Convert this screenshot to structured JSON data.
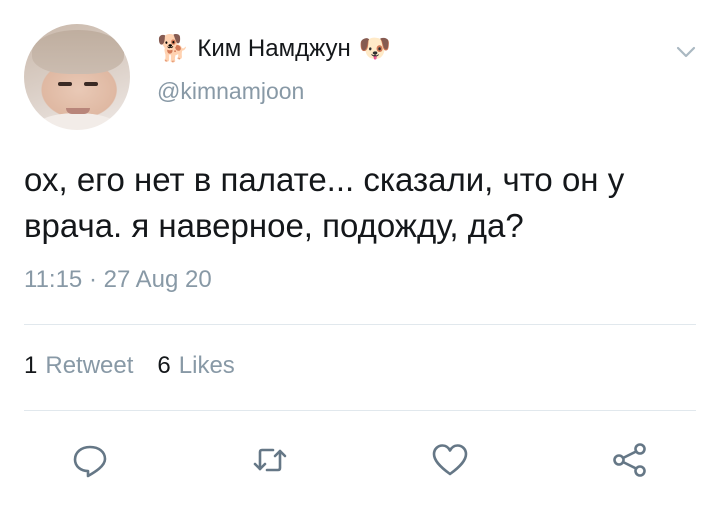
{
  "tweet": {
    "name_prefix_emoji": "🐕",
    "display_name": "Ким Намджун",
    "name_suffix_emoji": "🐶",
    "handle": "@kimnamjoon",
    "text": "ох, его нет в палате... сказали, что он у врача. я наверное, подожду, да?",
    "timestamp": "11:15 · 27 Aug 20"
  },
  "stats": {
    "retweets_count": "1",
    "retweets_label": "Retweet",
    "likes_count": "6",
    "likes_label": "Likes"
  },
  "icons": {
    "menu": "chevron-down-icon",
    "reply": "reply-icon",
    "retweet": "retweet-icon",
    "like": "heart-icon",
    "share": "share-icon"
  },
  "colors": {
    "text": "#14171a",
    "secondary": "#8899a6",
    "icon": "#657786",
    "divider": "#e1e8ed"
  }
}
